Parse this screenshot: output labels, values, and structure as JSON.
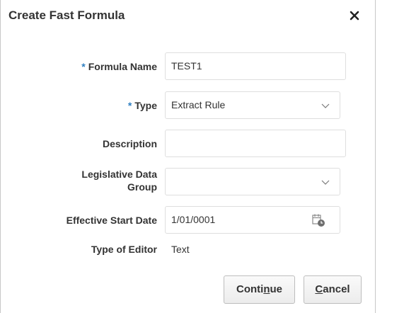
{
  "dialog": {
    "title": "Create Fast Formula"
  },
  "form": {
    "required_marker": "*",
    "formula_name": {
      "label": "Formula Name",
      "value": "TEST1"
    },
    "type": {
      "label": "Type",
      "value": "Extract Rule"
    },
    "description": {
      "label": "Description",
      "value": ""
    },
    "legislative_data_group": {
      "label_line1": "Legislative Data",
      "label_line2": "Group",
      "value": ""
    },
    "effective_start_date": {
      "label": "Effective Start Date",
      "value": "1/01/0001"
    },
    "type_of_editor": {
      "label": "Type of Editor",
      "value": "Text"
    }
  },
  "buttons": {
    "continue_pre": "Conti",
    "continue_mnemonic": "n",
    "continue_post": "ue",
    "cancel_mnemonic": "C",
    "cancel_post": "ancel"
  },
  "icons": {
    "close": "close-icon",
    "dropdown": "chevron-down-icon",
    "calendar": "calendar-icon"
  },
  "colors": {
    "required": "#2f7fc1",
    "border": "#dedede",
    "text": "#333333"
  }
}
